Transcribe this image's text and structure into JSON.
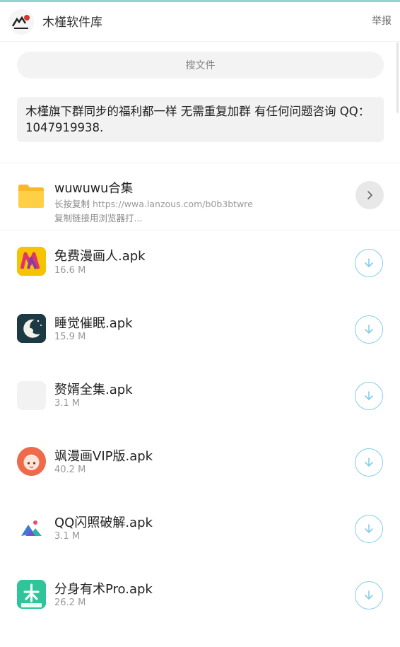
{
  "header": {
    "site_name": "木槿软件库",
    "report_label": "举报"
  },
  "search": {
    "label": "搜文件"
  },
  "notice": {
    "text": "木槿旗下群同步的福利都一样 无需重复加群 有任何问题咨询 QQ：1047919938."
  },
  "folder": {
    "name": "wuwuwu合集",
    "desc_prefix": "长按复制",
    "desc_url": "https://wwa.lanzous.com/b0b3btwre",
    "desc_suffix": "复制链接用浏览器打..."
  },
  "files": [
    {
      "name": "免费漫画人.apk",
      "size": "16.6 M",
      "icon": "manhuaren-app-icon"
    },
    {
      "name": "睡觉催眠.apk",
      "size": "15.9 M",
      "icon": "sleep-moon-app-icon"
    },
    {
      "name": "赘婿全集.apk",
      "size": "3.1 M",
      "icon": "blank-app-icon"
    },
    {
      "name": "飒漫画VIP版.apk",
      "size": "40.2 M",
      "icon": "anime-girl-app-icon"
    },
    {
      "name": "QQ闪照破解.apk",
      "size": "3.1 M",
      "icon": "gallery-app-icon"
    },
    {
      "name": "分身有术Pro.apk",
      "size": "26.2 M",
      "icon": "fenshen-app-icon"
    }
  ],
  "colors": {
    "accent_download": "#86ccea",
    "folder_yellow": "#ffcb3b",
    "top_border": "#8fd6d0"
  }
}
